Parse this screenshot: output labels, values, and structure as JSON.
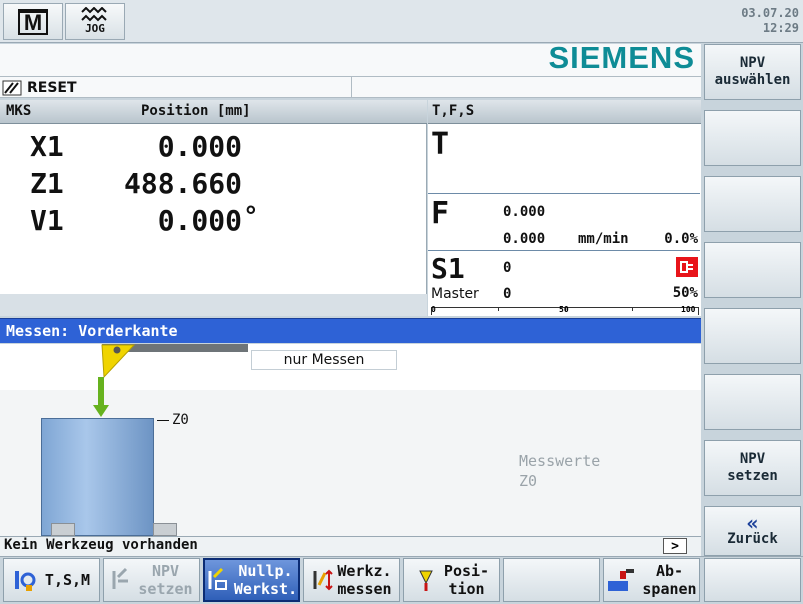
{
  "header": {
    "mode_icon_letter": "M",
    "jog_label": "JOG",
    "date": "03.07.20",
    "time": "12:29"
  },
  "brand": "SIEMENS",
  "status": {
    "reset": "RESET"
  },
  "position_panel": {
    "col_system": "MKS",
    "col_position": "Position [mm]",
    "axes": [
      {
        "name": "X1",
        "value": "0.000",
        "unit": ""
      },
      {
        "name": "Z1",
        "value": "488.660",
        "unit": ""
      },
      {
        "name": "V1",
        "value": "0.000",
        "unit": "°"
      }
    ]
  },
  "tfs_panel": {
    "title": "T,F,S",
    "t_label": "T",
    "f_label": "F",
    "f_value1": "0.000",
    "f_value2": "0.000",
    "f_unit": "mm/min",
    "f_percent": "0.0%",
    "s_label": "S1",
    "s_value": "0",
    "master_label": "Master",
    "master_value": "0",
    "spindle_percent": "50%",
    "spindle_load_percent": 0,
    "scale": [
      "0",
      "50",
      "100"
    ]
  },
  "measure": {
    "title": "Messen: Vorderkante",
    "mode_field": "nur Messen",
    "z0_label": "Z0",
    "messwerte": "Messwerte",
    "messwerte_value": "Z0"
  },
  "message": {
    "text": "Kein Werkzeug vorhanden",
    "scroll": ">"
  },
  "vertical_softkeys": [
    {
      "label": "NPV auswählen",
      "line1": "NPV",
      "line2": "auswählen"
    },
    {
      "label": ""
    },
    {
      "label": ""
    },
    {
      "label": ""
    },
    {
      "label": ""
    },
    {
      "label": ""
    },
    {
      "label": "NPV setzen",
      "line1": "NPV",
      "line2": "setzen"
    },
    {
      "label": "Zurück",
      "symbol": "«",
      "line2": "Zurück"
    }
  ],
  "horizontal_softkeys": [
    {
      "line1": "T,S,M",
      "line2": "",
      "state": "normal"
    },
    {
      "line1": "NPV",
      "line2": "setzen",
      "state": "disabled"
    },
    {
      "line1": "Nullp.",
      "line2": "Werkst.",
      "state": "active"
    },
    {
      "line1": "Werkz.",
      "line2": "messen",
      "state": "normal"
    },
    {
      "line1": "Posi-",
      "line2": "tion",
      "state": "normal"
    },
    {
      "line1": "",
      "line2": "",
      "state": "normal"
    },
    {
      "line1": "Ab-",
      "line2": "spanen",
      "state": "normal"
    },
    {
      "line1": "",
      "line2": "",
      "state": "normal"
    }
  ],
  "colors": {
    "active_blue": "#2f5fb8",
    "title_bar": "#2e62d6",
    "spindle_red": "#e8141a",
    "siemens_teal": "#0e8c96"
  }
}
